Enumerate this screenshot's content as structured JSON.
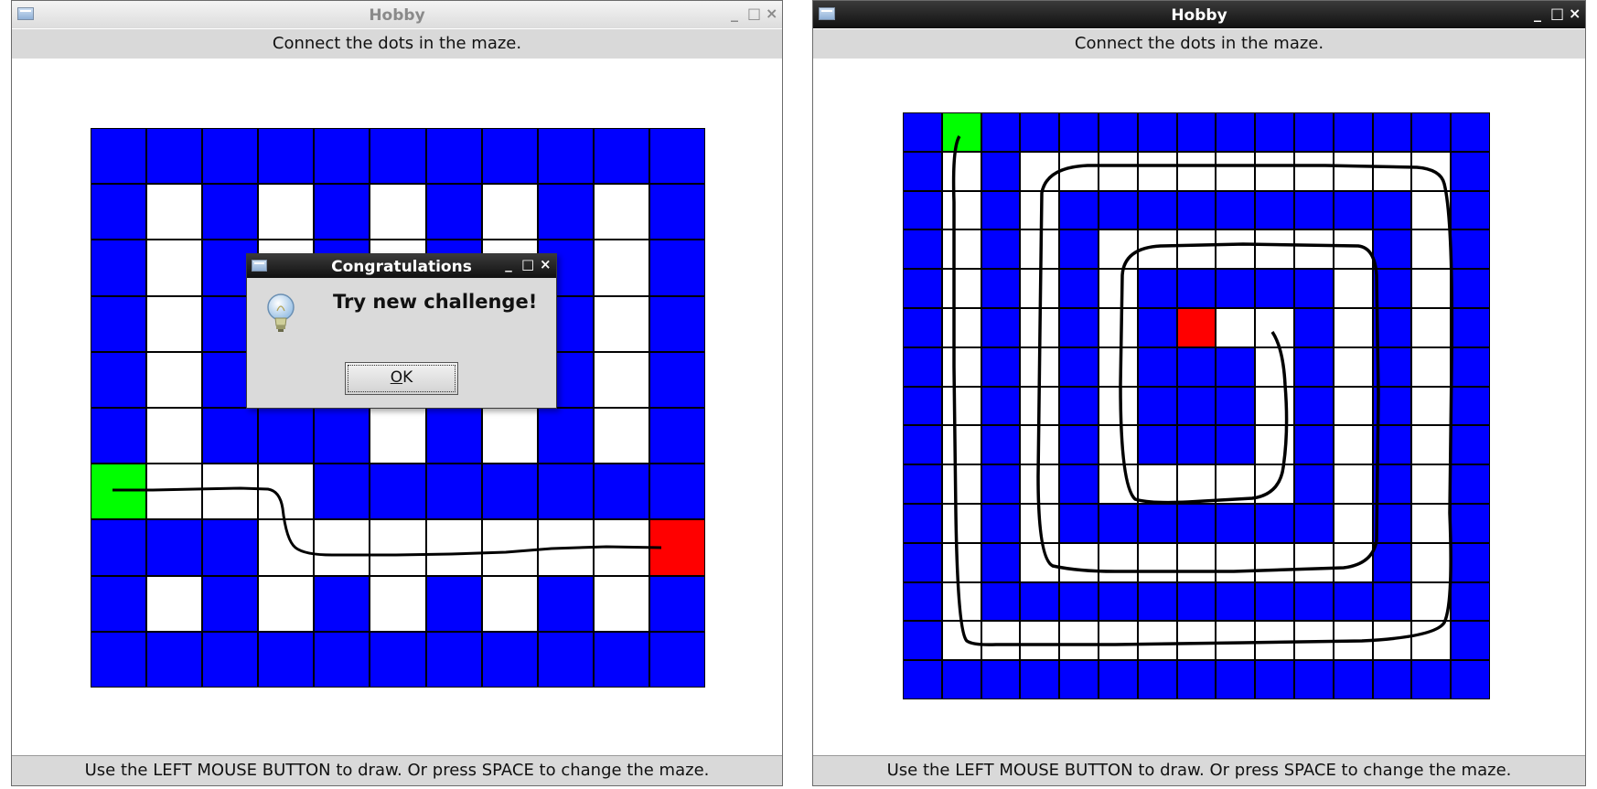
{
  "windows": [
    {
      "title": "Hobby",
      "header": "Connect the dots in the maze.",
      "footer": "Use the LEFT MOUSE BUTTON to draw. Or press SPACE to change the maze.",
      "controls": [
        "minimize-icon",
        "maximize-icon",
        "close-icon"
      ],
      "maze": {
        "columns": 11,
        "rows": 10,
        "legend": {
          "b": "wall (blue)",
          "w": "open path (white)",
          "g": "start dot (green)",
          "r": "end dot (red)"
        },
        "grid": [
          "bbbbbbbbbbb",
          "bwbwbwbwbwb",
          "bwbwbwbwbwb",
          "bwbwbwbwbwb",
          "bwbwbwbwbwb",
          "bwbbbwbwbwb",
          "gwwwbbbbbbb",
          "bbbwwwwwwwr",
          "bwbwbwbwbwb",
          "bbbbbbbbbbb"
        ]
      },
      "dialog": {
        "title": "Congratulations",
        "message": "Try new challenge!",
        "ok_label": "OK",
        "icon": "lightbulb-icon"
      }
    },
    {
      "title": "Hobby",
      "header": "Connect the dots in the maze.",
      "footer": "Use the LEFT MOUSE BUTTON to draw. Or press SPACE to change the maze.",
      "controls": [
        "minimize-icon",
        "maximize-icon",
        "close-icon"
      ],
      "maze": {
        "columns": 15,
        "rows": 15,
        "legend": {
          "b": "wall (blue)",
          "w": "open path (white)",
          "g": "start dot (green)",
          "r": "end dot (red)"
        },
        "grid": [
          "bgbbbbbbbbbbbbb",
          "bwbwwwwwwwwwwwb",
          "bwbwbbbbbbbbbwb",
          "bwbwbwwwwwwwbwb",
          "bwbwbwbbbbbwbwb",
          "bwbwbwbrwwbwbwb",
          "bwbwbwbbbwbwbwb",
          "bwbwbwbbbwbwbwb",
          "bwbwbwbbbwbwbwb",
          "bwbwbwwwwwbwbwb",
          "bwbwbbbbbbbwbwb",
          "bwbwwwwwwwwwbwb",
          "bwbbbbbbbbbbbwb",
          "bwwwwwwwwwwwwwb",
          "bbbbbbbbbbbbbbb"
        ]
      }
    }
  ],
  "colors": {
    "wall": "#0000ff",
    "open": "#ffffff",
    "start": "#00ff00",
    "end": "#ff0000",
    "ink": "#000000"
  }
}
